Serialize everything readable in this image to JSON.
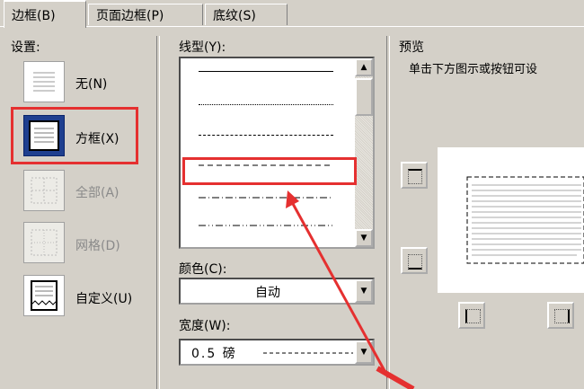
{
  "tabs": [
    {
      "label": "边框(B)",
      "active": true
    },
    {
      "label": "页面边框(P)",
      "active": false
    },
    {
      "label": "底纹(S)",
      "active": false
    }
  ],
  "settings": {
    "label": "设置:",
    "items": [
      {
        "label": "无(N)",
        "icon": "no-border-icon",
        "disabled": false
      },
      {
        "label": "方框(X)",
        "icon": "box-border-icon",
        "disabled": false,
        "selected": true
      },
      {
        "label": "全部(A)",
        "icon": "all-borders-icon",
        "disabled": true
      },
      {
        "label": "网格(D)",
        "icon": "grid-borders-icon",
        "disabled": true
      },
      {
        "label": "自定义(U)",
        "icon": "custom-border-icon",
        "disabled": false
      }
    ]
  },
  "line_style": {
    "label": "线型(Y):",
    "options": [
      "solid",
      "dotted",
      "dashed-fine",
      "dashed",
      "dash-dot",
      "dash-dot-dot"
    ],
    "selected": "dashed"
  },
  "color": {
    "label": "颜色(C):",
    "value": "自动"
  },
  "width": {
    "label": "宽度(W):",
    "value": "0.5 磅"
  },
  "preview": {
    "label": "预览",
    "hint": "单击下方图示或按钮可设"
  },
  "colors": {
    "highlight": "#e53030",
    "dialog_bg": "#d4d0c8"
  }
}
